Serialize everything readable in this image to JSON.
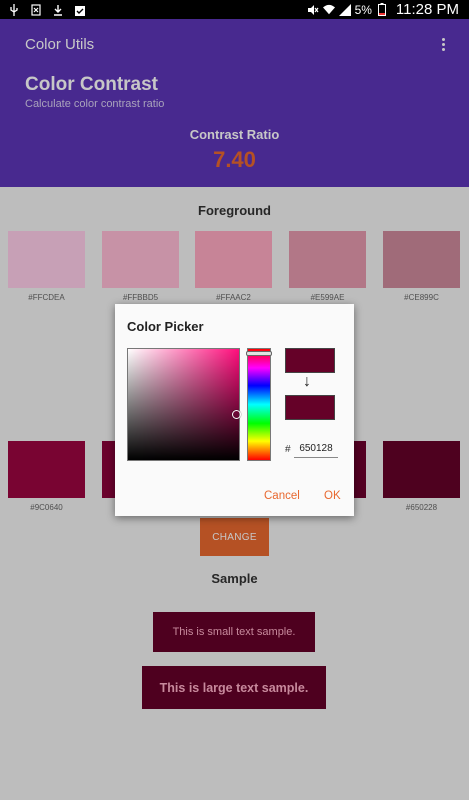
{
  "status_bar": {
    "battery": "5%",
    "time": "11:28 PM",
    "icons": [
      "usb-icon",
      "sim-icon",
      "download-icon",
      "clipboard-check-icon",
      "mute-icon",
      "wifi-icon",
      "signal-icon",
      "battery-icon"
    ]
  },
  "app_bar": {
    "title": "Color Utils",
    "overflow_icon": "more-vert-icon"
  },
  "header": {
    "title": "Color Contrast",
    "subtitle": "Calculate color contrast ratio",
    "ratio_label": "Contrast Ratio",
    "ratio_value": "7.40"
  },
  "foreground": {
    "title": "Foreground",
    "swatches": [
      {
        "hex": "#FFCDEA",
        "color": "#ffcdea"
      },
      {
        "hex": "#FFBBD5",
        "color": "#ffbbd5"
      },
      {
        "hex": "#FFAAC2",
        "color": "#ffaac2"
      },
      {
        "hex": "#E599AE",
        "color": "#e599ae"
      },
      {
        "hex": "#CE899C",
        "color": "#ce899c"
      }
    ]
  },
  "background_row": {
    "swatches": [
      {
        "hex": "#9C0640",
        "color": "#9c0640"
      },
      {
        "hex": "",
        "color": "#8a033a"
      },
      {
        "hex": "",
        "color": "#7a0234"
      },
      {
        "hex": "",
        "color": "#6c022e"
      },
      {
        "hex": "#650228",
        "color": "#650228"
      }
    ]
  },
  "change_button": "CHANGE",
  "sample": {
    "title": "Sample",
    "small_text": "This is small text sample.",
    "large_text": "This is large text sample."
  },
  "dialog": {
    "title": "Color Picker",
    "hash": "#",
    "hex_value": "650128",
    "old_color": "#650128",
    "new_color": "#650128",
    "arrow": "↓",
    "cancel": "Cancel",
    "ok": "OK"
  },
  "colors": {
    "primary": "#5d35b8",
    "accent": "#e8682f",
    "sample_bg": "#650128",
    "sample_fg": "#ffb0c8"
  }
}
